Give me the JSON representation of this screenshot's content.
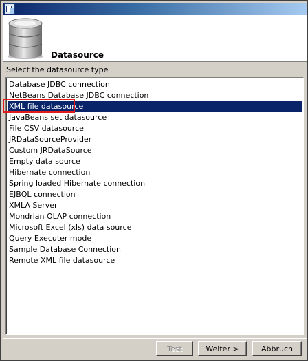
{
  "window": {
    "title": ""
  },
  "header": {
    "title": "Datasource",
    "icon": "database-icon"
  },
  "section": {
    "label": "Select the datasource type"
  },
  "datasource_list": {
    "selected_index": 2,
    "items": [
      "Database JDBC connection",
      "NetBeans Database JDBC connection",
      "XML file datasource",
      "JavaBeans set datasource",
      "File CSV datasource",
      "JRDataSourceProvider",
      "Custom JRDataSource",
      "Empty data source",
      "Hibernate connection",
      "Spring loaded Hibernate connection",
      "EJBQL connection",
      "XMLA Server",
      "Mondrian OLAP connection",
      "Microsoft Excel (xls) data source",
      "Query Executer mode",
      "Sample Database Connection",
      "Remote XML file datasource"
    ]
  },
  "buttons": {
    "test": "Test",
    "next": "Weiter >",
    "cancel": "Abbruch"
  },
  "colors": {
    "selection": "#0a246a",
    "highlight_box": "#e31b1b",
    "title_gradient_start": "#0a246a"
  }
}
